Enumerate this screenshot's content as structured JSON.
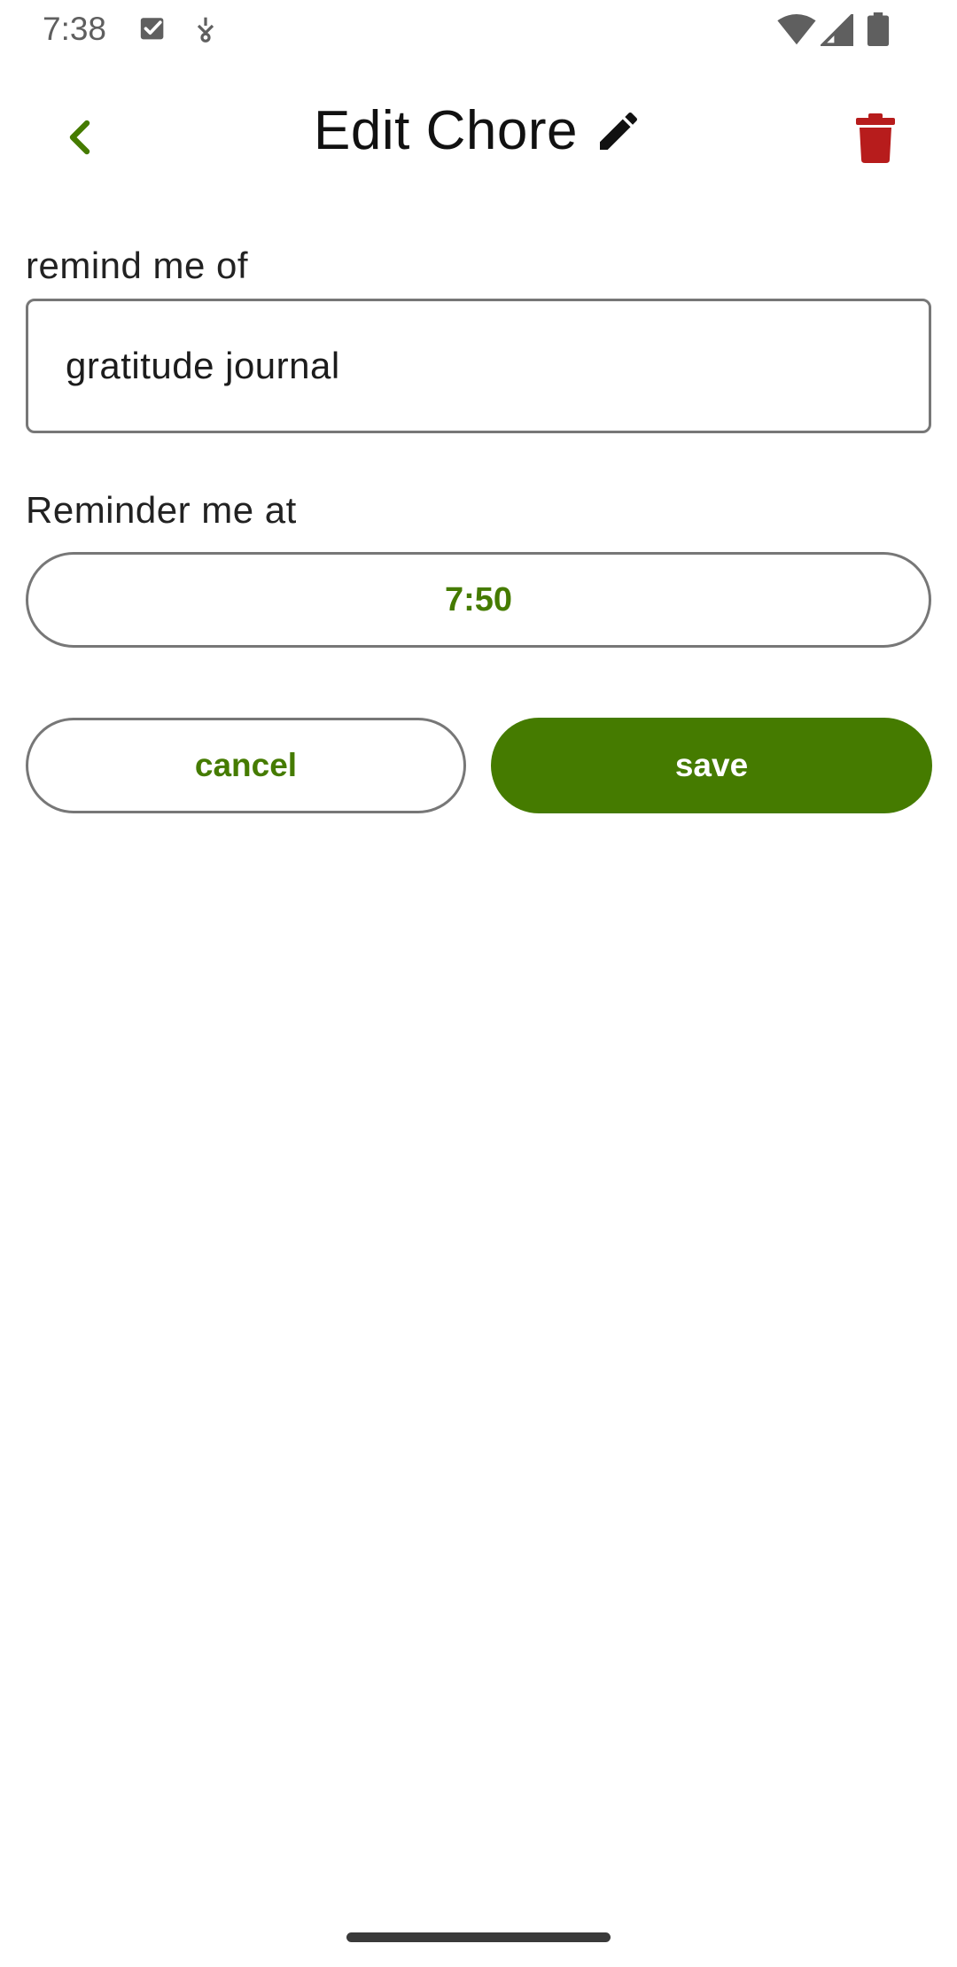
{
  "status_bar": {
    "time": "7:38",
    "icons": [
      "checkbox-notification-icon",
      "vpn-key-icon",
      "wifi-icon",
      "cell-signal-icon",
      "battery-icon"
    ]
  },
  "app_bar": {
    "title": "Edit Chore",
    "back_icon": "chevron-left-icon",
    "title_icon": "pencil-icon",
    "delete_icon": "trash-icon"
  },
  "form": {
    "remind_label": "remind me of",
    "remind_value": "gratitude journal",
    "time_label": "Reminder me at",
    "time_value": "7:50"
  },
  "actions": {
    "cancel_label": "cancel",
    "save_label": "save"
  },
  "colors": {
    "accent": "#457b00",
    "danger": "#b71c1c",
    "border": "#777777",
    "text": "#1c1c1c"
  }
}
